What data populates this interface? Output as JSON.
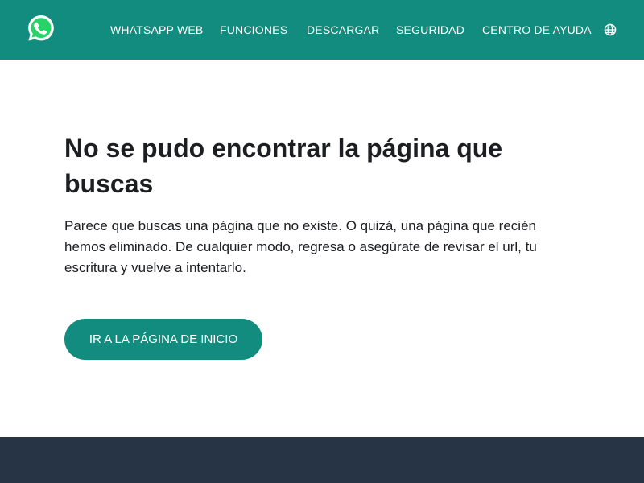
{
  "colors": {
    "brand": "#128c7e",
    "footer": "#263445",
    "text": "#1c1e21",
    "white": "#ffffff"
  },
  "header": {
    "logo_icon": "whatsapp-logo-icon",
    "nav_items": [
      {
        "label": "WHATSAPP WEB"
      },
      {
        "label": "FUNCIONES"
      },
      {
        "label": "DESCARGAR"
      },
      {
        "label": "SEGURIDAD"
      },
      {
        "label": "CENTRO DE AYUDA"
      }
    ],
    "language_icon": "globe-icon"
  },
  "main": {
    "title": "No se pudo encontrar la página que buscas",
    "description": "Parece que buscas una página que no existe. O quizá, una página que recién hemos eliminado. De cualquier modo, regresa o asegúrate de revisar el url, tu escritura y vuelve a intentarlo.",
    "home_button_label": "IR A LA PÁGINA DE INICIO"
  }
}
